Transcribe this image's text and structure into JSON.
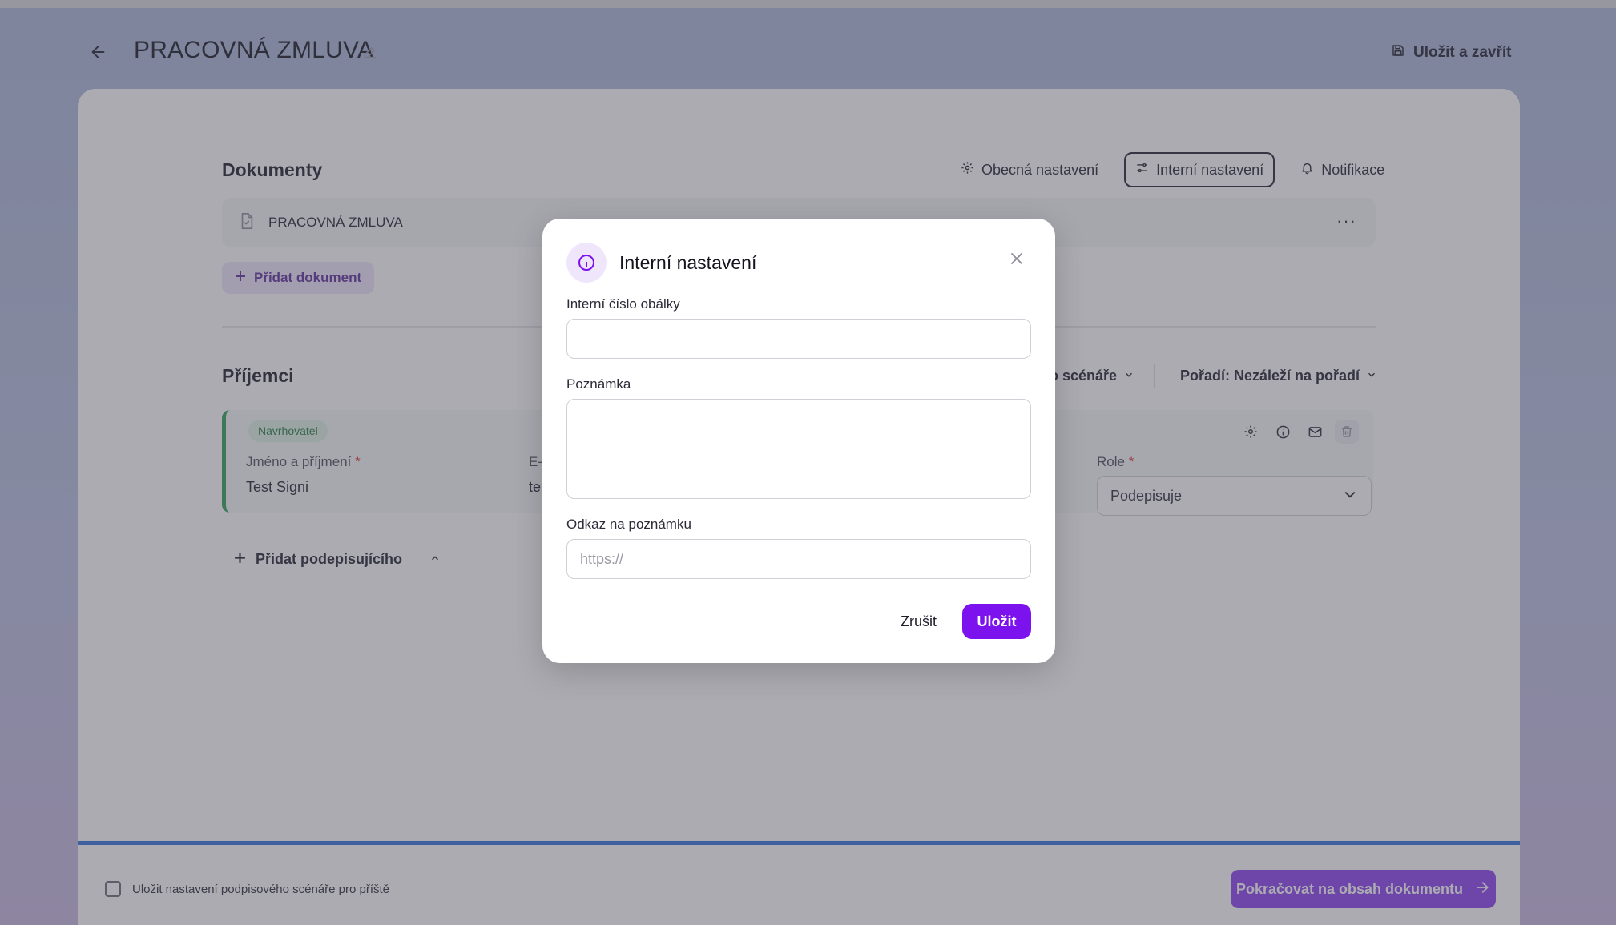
{
  "header": {
    "title": "PRACOVNÁ ZMLUVA",
    "save_close_label": "Uložit a zavřít"
  },
  "documents": {
    "section_title": "Dokumenty",
    "tabs": [
      {
        "label": "Obecná nastavení",
        "icon": "gear-icon"
      },
      {
        "label": "Interní nastavení",
        "icon": "sliders-icon"
      },
      {
        "label": "Notifikace",
        "icon": "bell-icon"
      }
    ],
    "active_tab": "Interní nastavení",
    "items": [
      {
        "name": "PRACOVNÁ ZMLUVA"
      }
    ],
    "add_document_label": "Přidat dokument"
  },
  "recipients": {
    "section_title": "Příjemci",
    "scenario_label": "o scénáře",
    "order_label": "Pořadí: Nezáleží na pořadí",
    "items": [
      {
        "badge": "Navrhovatel",
        "name_label": "Jméno a příjmení",
        "name_value": "Test Signi",
        "email_label": "E-",
        "email_value": "te",
        "role_label": "Role",
        "role_value": "Podepisuje"
      }
    ],
    "add_signer_label": "Přidat podepisujícího"
  },
  "footer": {
    "remember_label": "Uložit nastavení podpisového scénáře pro příště",
    "continue_label": "Pokračovat na obsah dokumentu"
  },
  "modal": {
    "title": "Interní nastavení",
    "envelope_number_label": "Interní číslo obálky",
    "envelope_number_value": "",
    "note_label": "Poznámka",
    "note_value": "",
    "note_link_label": "Odkaz na poznámku",
    "note_link_placeholder": "https://",
    "cancel_label": "Zrušit",
    "save_label": "Uložit"
  },
  "colors": {
    "accent": "#7c12ee",
    "continue_button": "#8a3df0",
    "recipient_bar": "#2f9e55",
    "progress": "#2f6fe0"
  }
}
